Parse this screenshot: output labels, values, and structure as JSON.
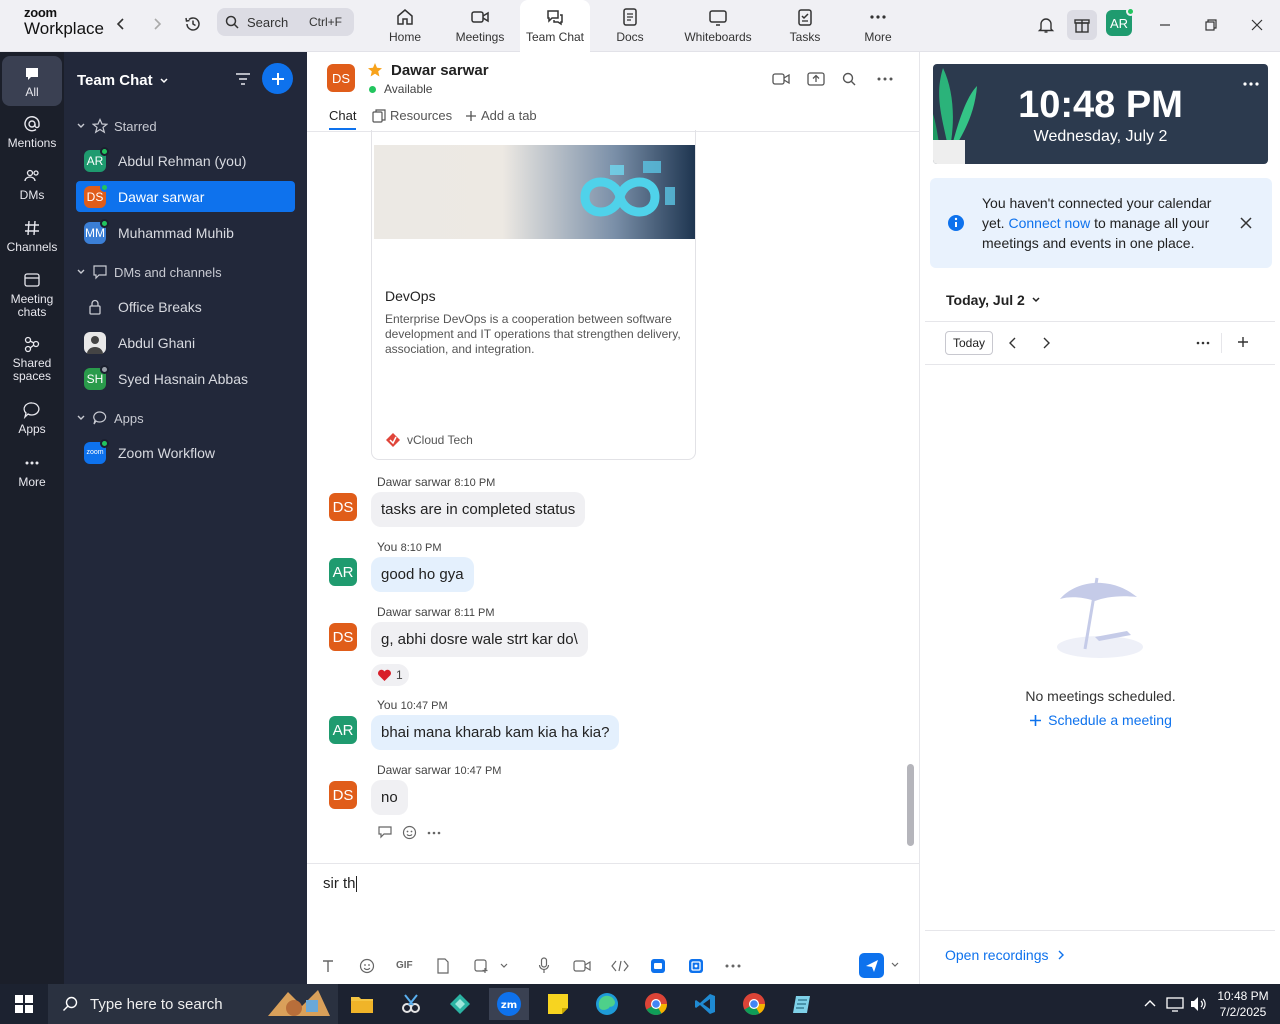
{
  "brand": {
    "line1": "zoom",
    "line2": "Workplace"
  },
  "colors": {
    "accent": "#0e72ed",
    "rail_bg": "#1b1f2a",
    "sidebar_bg": "#22283a",
    "online": "#22c55e",
    "clock_bg": "#2c3a4e"
  },
  "search": {
    "placeholder": "Search",
    "shortcut": "Ctrl+F"
  },
  "tabs": [
    {
      "label": "Home",
      "icon": "home-icon"
    },
    {
      "label": "Meetings",
      "icon": "video-icon"
    },
    {
      "label": "Team Chat",
      "icon": "chat-icon",
      "active": true
    },
    {
      "label": "Docs",
      "icon": "doc-icon"
    },
    {
      "label": "Whiteboards",
      "icon": "whiteboard-icon"
    },
    {
      "label": "Tasks",
      "icon": "tasks-icon"
    },
    {
      "label": "More",
      "icon": "more-icon"
    }
  ],
  "user": {
    "initials": "AR"
  },
  "rail": {
    "all": "All",
    "mentions": "Mentions",
    "dms": "DMs",
    "channels": "Channels",
    "meeting_chats": "Meeting chats",
    "shared_spaces": "Shared spaces",
    "apps": "Apps",
    "more": "More"
  },
  "sidebar": {
    "title": "Team Chat",
    "starred_label": "Starred",
    "starred": [
      {
        "initials": "AR",
        "name": "Abdul Rehman (you)"
      },
      {
        "initials": "DS",
        "name": "Dawar sarwar"
      },
      {
        "initials": "MM",
        "name": "Muhammad Muhib"
      }
    ],
    "dms_label": "DMs and channels",
    "dms": [
      {
        "name": "Office Breaks"
      },
      {
        "name": "Abdul Ghani"
      },
      {
        "initials": "SH",
        "name": "Syed Hasnain Abbas"
      }
    ],
    "apps_label": "Apps",
    "apps": [
      {
        "initials": "zoom",
        "name": "Zoom Workflow"
      }
    ]
  },
  "chat": {
    "contact_initials": "DS",
    "contact_name": "Dawar sarwar",
    "status": "Available",
    "tabs": {
      "chat": "Chat",
      "resources": "Resources",
      "add": "Add a tab"
    },
    "card": {
      "title": "DevOps",
      "description": "Enterprise DevOps is a cooperation between software development and IT operations that strengthen delivery, association, and integration.",
      "source": "vCloud Tech"
    },
    "messages": [
      {
        "initials": "DS",
        "name": "Dawar sarwar",
        "time": "8:10 PM",
        "text": "tasks are in completed status"
      },
      {
        "initials": "AR",
        "name": "You",
        "time": "8:10 PM",
        "text": "good ho gya"
      },
      {
        "initials": "DS",
        "name": "Dawar sarwar",
        "time": "8:11 PM",
        "text": "g, abhi dosre wale strt kar do\\",
        "reaction_count": "1"
      },
      {
        "initials": "AR",
        "name": "You",
        "time": "10:47 PM",
        "text": "bhai mana kharab kam kia ha kia?"
      },
      {
        "initials": "DS",
        "name": "Dawar sarwar",
        "time": "10:47 PM",
        "text": "no"
      }
    ],
    "composer_text": "sir th",
    "composer_gif": "GIF"
  },
  "calendar": {
    "time": "10:48 PM",
    "date": "Wednesday, July 2",
    "notice_pre": "You haven't connected your calendar yet.",
    "notice_link": "Connect now",
    "notice_post": "to manage all your meetings and events in one place.",
    "day_label": "Today, Jul 2",
    "today_button": "Today",
    "empty_text": "No meetings scheduled.",
    "schedule_link": "Schedule a meeting",
    "recordings_link": "Open recordings"
  },
  "taskbar": {
    "search_placeholder": "Type here to search",
    "time": "10:48 PM",
    "date": "7/2/2025",
    "apps": [
      "file-explorer-icon",
      "snipping-icon",
      "app-icon",
      "zoom-icon",
      "sticky-notes-icon",
      "edge-icon",
      "chrome-icon",
      "vscode-icon",
      "chrome-icon",
      "notepad-icon"
    ]
  }
}
